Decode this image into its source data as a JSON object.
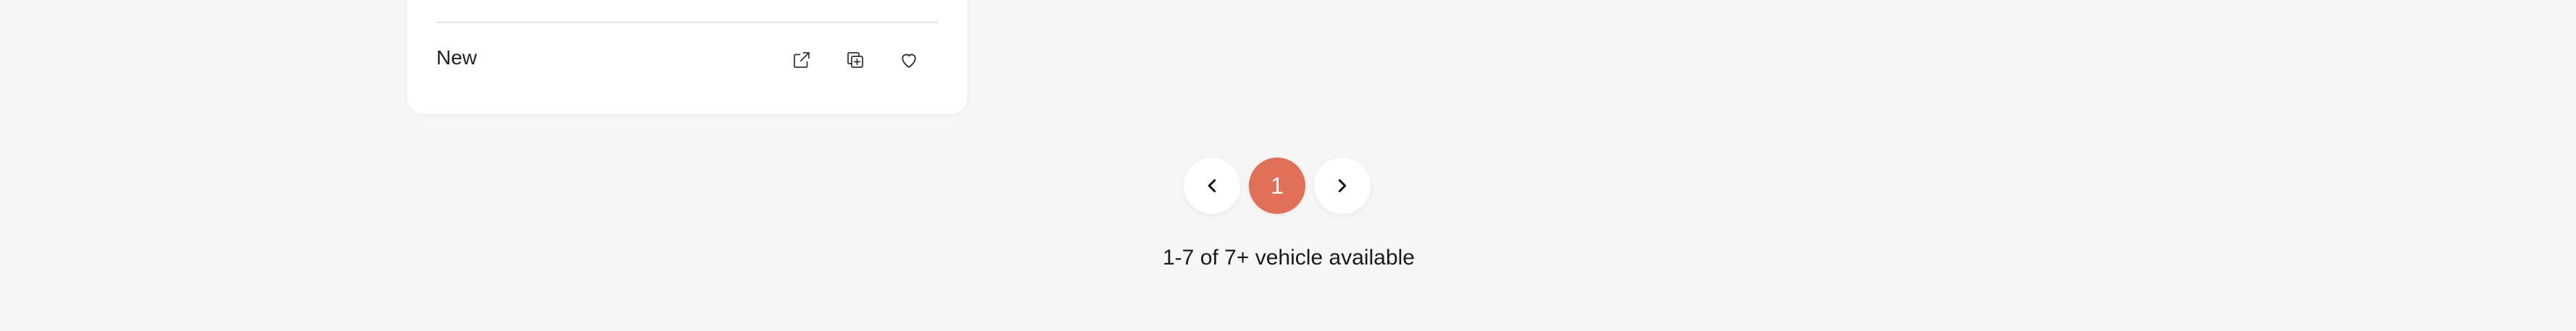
{
  "listing_card": {
    "condition": "New",
    "actions": [
      {
        "name": "open-external-icon"
      },
      {
        "name": "compare-icon"
      },
      {
        "name": "heart-icon"
      }
    ]
  },
  "pagination": {
    "prev_icon": "chevron-left-icon",
    "current_page": "1",
    "next_icon": "chevron-right-icon",
    "active_color": "#e07058"
  },
  "results_summary": "1-7 of 7+ vehicle available"
}
